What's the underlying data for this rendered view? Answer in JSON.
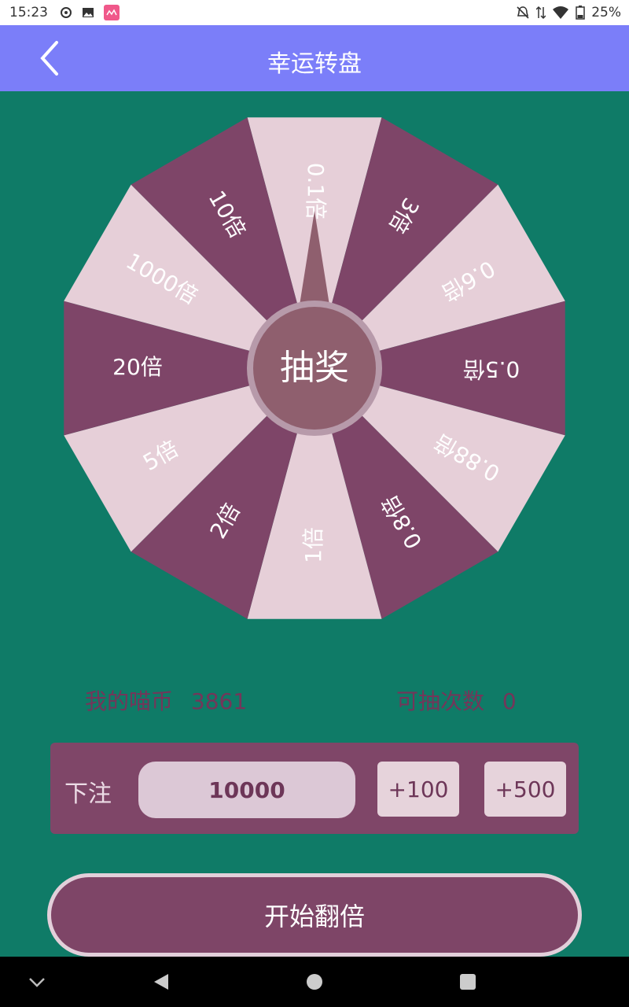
{
  "status_bar": {
    "time": "15:23",
    "battery": "25%"
  },
  "app_bar": {
    "title": "幸运转盘"
  },
  "wheel": {
    "center_label": "抽奖",
    "segments": [
      "0.1倍",
      "3倍",
      "0.6倍",
      "0.5倍",
      "0.88倍",
      "0.8倍",
      "1倍",
      "2倍",
      "5倍",
      "20倍",
      "1000倍",
      "10倍"
    ],
    "colors": {
      "light": "#e6cfd8",
      "dark": "#7e4568",
      "hub": "#8f5f6e",
      "hub_ring": "#b79aaa"
    }
  },
  "stats": {
    "coins_label": "我的喵币",
    "coins_value": "3861",
    "draws_label": "可抽次数",
    "draws_value": "0"
  },
  "bet": {
    "label": "下注",
    "value": "10000",
    "plus100": "+100",
    "plus500": "+500"
  },
  "start_button": "开始翻倍",
  "colors": {
    "background": "#0f7b67",
    "app_bar": "#7b7ef9",
    "accent": "#7e4568"
  }
}
